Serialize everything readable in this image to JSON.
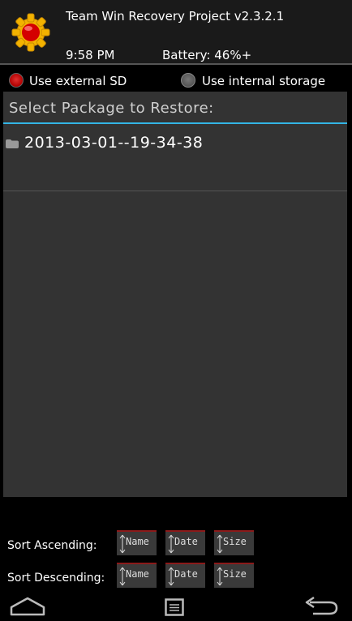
{
  "header": {
    "title": "Team Win Recovery Project  v2.3.2.1",
    "time": "9:58 PM",
    "battery": "Battery: 46%+"
  },
  "storage": {
    "external_label": "Use external SD",
    "internal_label": "Use internal storage",
    "selected": "external"
  },
  "panel": {
    "title": "Select Package to Restore:",
    "files": [
      "2013-03-01--19-34-38"
    ]
  },
  "sort": {
    "ascending_label": "Sort Ascending:",
    "descending_label": "Sort Descending:",
    "buttons": [
      "Name",
      "Date",
      "Size"
    ]
  },
  "nav": {
    "icons": [
      "home-icon",
      "menu-icon",
      "back-icon"
    ]
  },
  "colors": {
    "accent": "#33b5e5",
    "selected_radio": "#c00000",
    "panel_bg": "#333333",
    "header_bg": "#1a1a1a"
  }
}
